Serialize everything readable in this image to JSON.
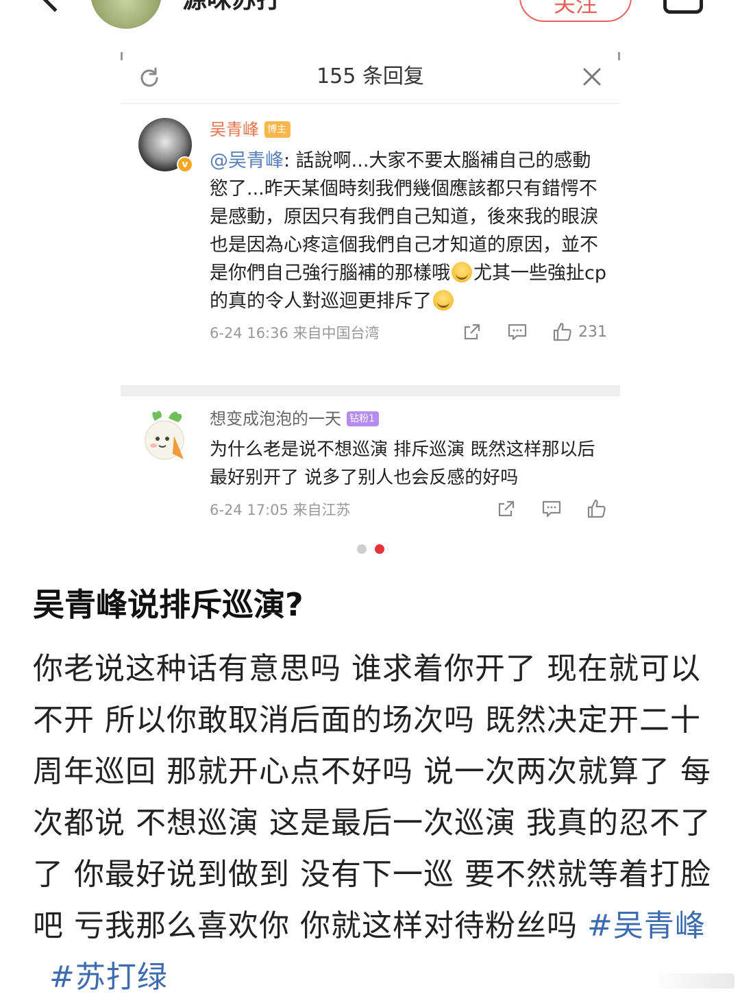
{
  "header": {
    "username": "源味苏打",
    "follow_label": "关注"
  },
  "panel": {
    "title": "155 条回复"
  },
  "comments": [
    {
      "name": "吴青峰",
      "badge": "博主",
      "mention": "@吴青峰",
      "text_part1": ": 話說啊...大家不要太腦補自己的感動慾了...昨天某個時刻我們幾個應該都只有錯愕不是感動，原因只有我們自己知道，後來我的眼淚也是因為心疼這個我們自己才知道的原因，並不是你們自己強行腦補的那樣哦",
      "text_part2": "尤其一些強扯cp的真的令人對巡迴更排斥了",
      "time": "6-24 16:36 来自中国台湾",
      "likes": "231"
    },
    {
      "name": "想变成泡泡的一天",
      "badge": "钻粉1",
      "text": "为什么老是说不想巡演 排斥巡演 既然这样那以后最好别开了 说多了别人也会反感的好吗",
      "time": "6-24 17:05 来自江苏",
      "likes": ""
    }
  ],
  "carousel": {
    "total": 2,
    "active": 2
  },
  "post": {
    "title": "吴青峰说排斥巡演?",
    "body": "你老说这种话有意思吗 谁求着你开了 现在就可以不开 所以你敢取消后面的场次吗 既然决定开二十周年巡回 那就开心点不好吗 说一次两次就算了 每次都说 不想巡演 这是最后一次巡演 我真的忍不了了 你最好说到做到 没有下一巡 要不然就等着打脸吧 亏我那么喜欢你 你就这样对待粉丝吗",
    "hashtags": [
      "#吴青峰",
      "#苏打绿"
    ]
  },
  "colors": {
    "follow": "#e8625c",
    "author_name": "#eb7350",
    "mention": "#5b7fb8",
    "hashtag": "#3c6bb0",
    "active_dot": "#e8333a"
  }
}
